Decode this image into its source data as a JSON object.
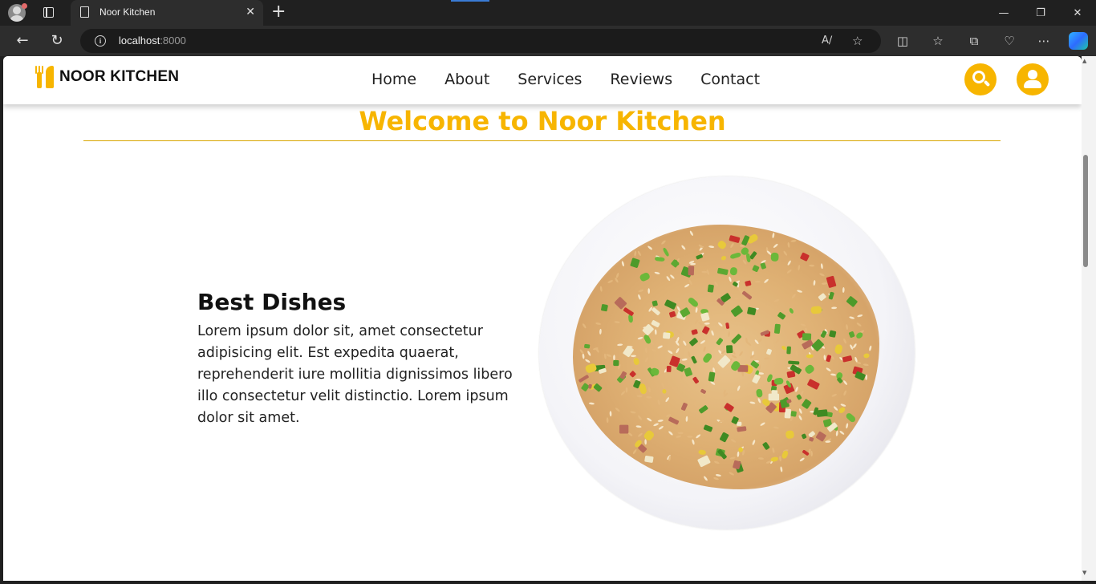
{
  "browser": {
    "tab_title": "Noor Kitchen",
    "tab_close": "✕",
    "new_tab": "+",
    "url_host": "localhost",
    "url_port": ":8000",
    "window_controls": [
      "—",
      "❐",
      "✕"
    ],
    "icons": [
      "profile-icon",
      "tab-actions-icon",
      "back-icon",
      "refresh-icon",
      "site-info-icon",
      "read-aloud-icon",
      "favorite-star-icon",
      "split-screen-icon",
      "favorites-icon",
      "collections-icon",
      "browser-essentials-icon",
      "more-icon",
      "copilot-icon"
    ]
  },
  "site": {
    "brand": "NOOR KITCHEN",
    "nav": [
      "Home",
      "About",
      "Services",
      "Reviews",
      "Contact"
    ],
    "accent_color": "#f7b500",
    "welcome_heading": "Welcome to Noor Kitchen",
    "section_title": "Best Dishes",
    "section_text": "Lorem ipsum dolor sit, amet consectetur adipisicing elit. Est expedita quaerat, reprehenderit iure mollitia dignissimos libero illo consectetur velit distinctio. Lorem ipsum dolor sit amet."
  }
}
